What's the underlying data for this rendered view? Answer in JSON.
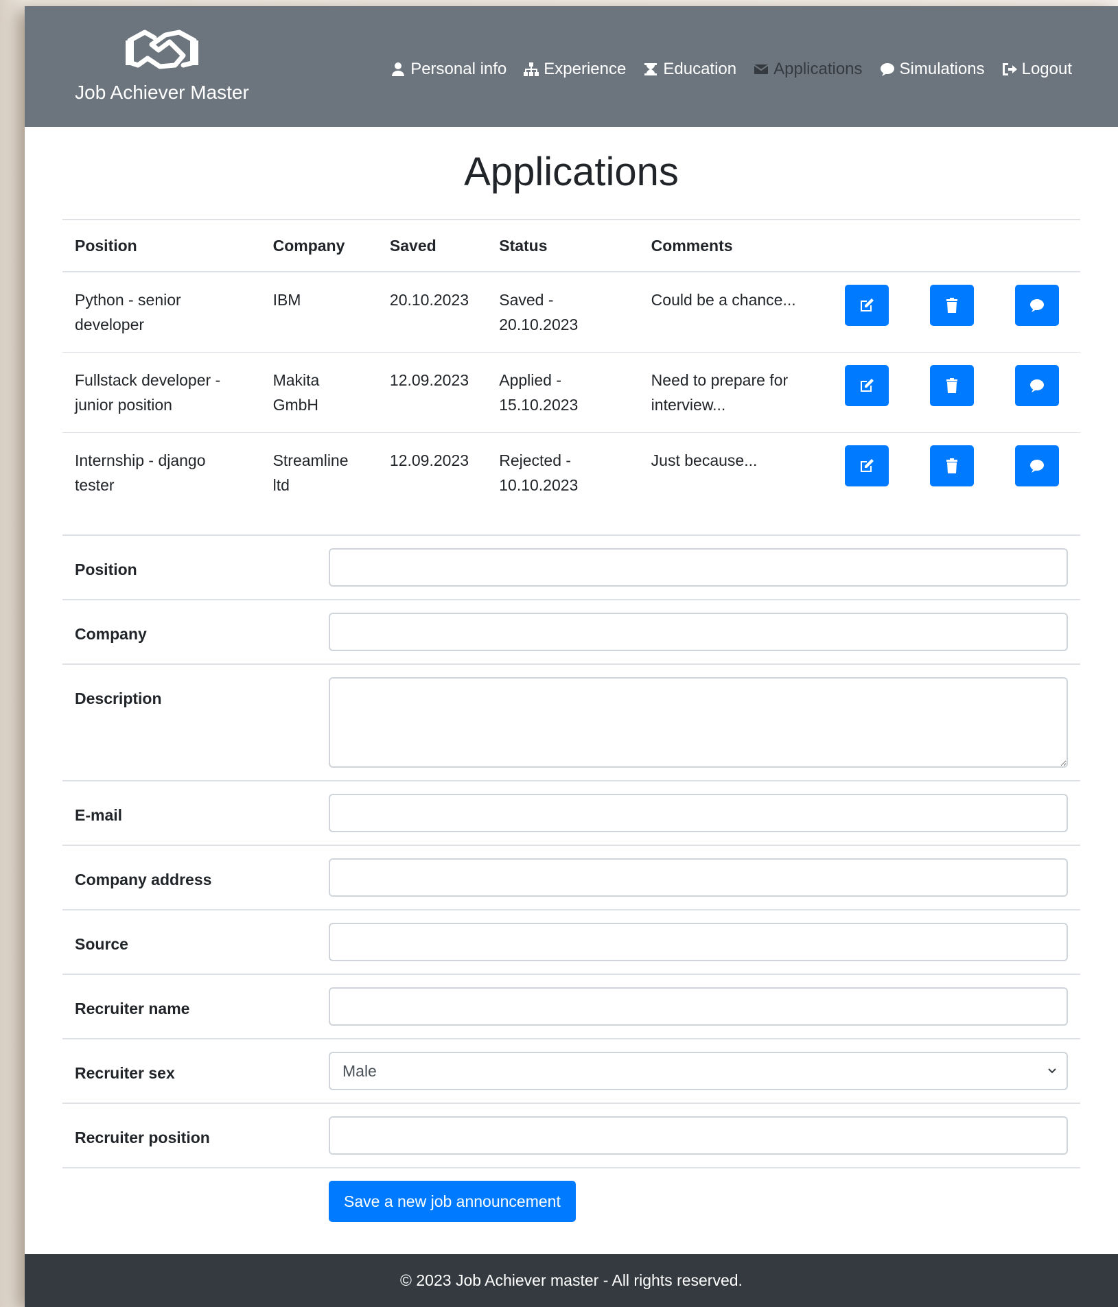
{
  "brand": {
    "title": "Job Achiever Master"
  },
  "nav": {
    "items": [
      {
        "label": "Personal info",
        "icon": "user-icon"
      },
      {
        "label": "Experience",
        "icon": "sitemap-icon"
      },
      {
        "label": "Education",
        "icon": "graduation-icon"
      },
      {
        "label": "Applications",
        "icon": "envelope-icon",
        "active": true
      },
      {
        "label": "Simulations",
        "icon": "comment-icon"
      },
      {
        "label": "Logout",
        "icon": "logout-icon"
      }
    ]
  },
  "page": {
    "title": "Applications"
  },
  "table": {
    "headers": [
      "Position",
      "Company",
      "Saved",
      "Status",
      "Comments"
    ],
    "rows": [
      {
        "position": "Python - senior developer",
        "company": "IBM",
        "saved": "20.10.2023",
        "status": "Saved - 20.10.2023",
        "comments": "Could be a chance..."
      },
      {
        "position": "Fullstack developer - junior position",
        "company": "Makita GmbH",
        "saved": "12.09.2023",
        "status": "Applied - 15.10.2023",
        "comments": "Need to prepare for interview..."
      },
      {
        "position": "Internship - django tester",
        "company": "Streamline ltd",
        "saved": "12.09.2023",
        "status": "Rejected - 10.10.2023",
        "comments": "Just because..."
      }
    ]
  },
  "form": {
    "position_label": "Position",
    "company_label": "Company",
    "description_label": "Description",
    "email_label": "E-mail",
    "company_address_label": "Company address",
    "source_label": "Source",
    "recruiter_name_label": "Recruiter name",
    "recruiter_sex_label": "Recruiter sex",
    "recruiter_sex_value": "Male",
    "recruiter_position_label": "Recruiter position",
    "submit_label": "Save a new job announcement"
  },
  "footer": {
    "text": "© 2023 Job Achiever master - All rights reserved."
  },
  "colors": {
    "header": "#6c757d",
    "primary": "#007bff",
    "footer": "#343a40",
    "nav_active": "#343a40"
  }
}
